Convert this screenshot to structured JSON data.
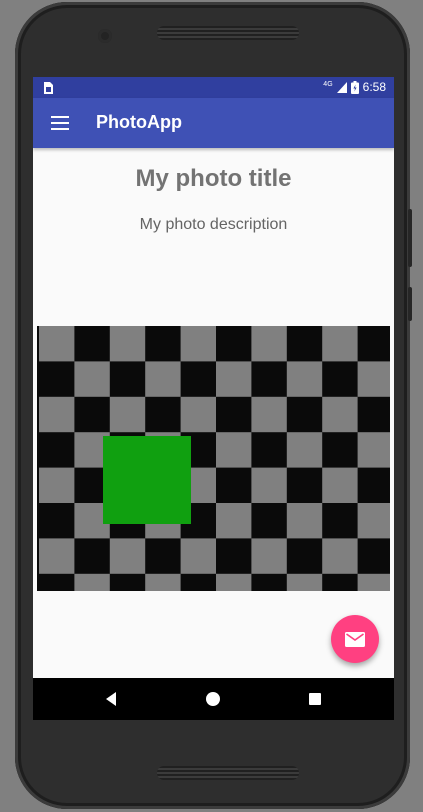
{
  "status_bar": {
    "network": "4G",
    "time": "6:58",
    "icons": [
      "sim-card-icon",
      "signal-icon",
      "battery-icon"
    ]
  },
  "app_bar": {
    "title": "PhotoApp",
    "menu_icon": "menu-icon"
  },
  "content": {
    "photo_title": "My photo title",
    "photo_description": "My photo description",
    "photo": {
      "pattern": "checkerboard",
      "colors": {
        "dark": "#0a0a0a",
        "light": "#808080",
        "overlay": "#10a010"
      }
    }
  },
  "fab": {
    "icon": "mail-icon",
    "color": "#ff4081"
  },
  "nav_bar": {
    "buttons": [
      "back-icon",
      "home-icon",
      "recents-icon"
    ]
  },
  "colors": {
    "primary": "#3f51b5",
    "primary_dark": "#303f9f",
    "accent": "#ff4081",
    "background": "#fafafa"
  }
}
